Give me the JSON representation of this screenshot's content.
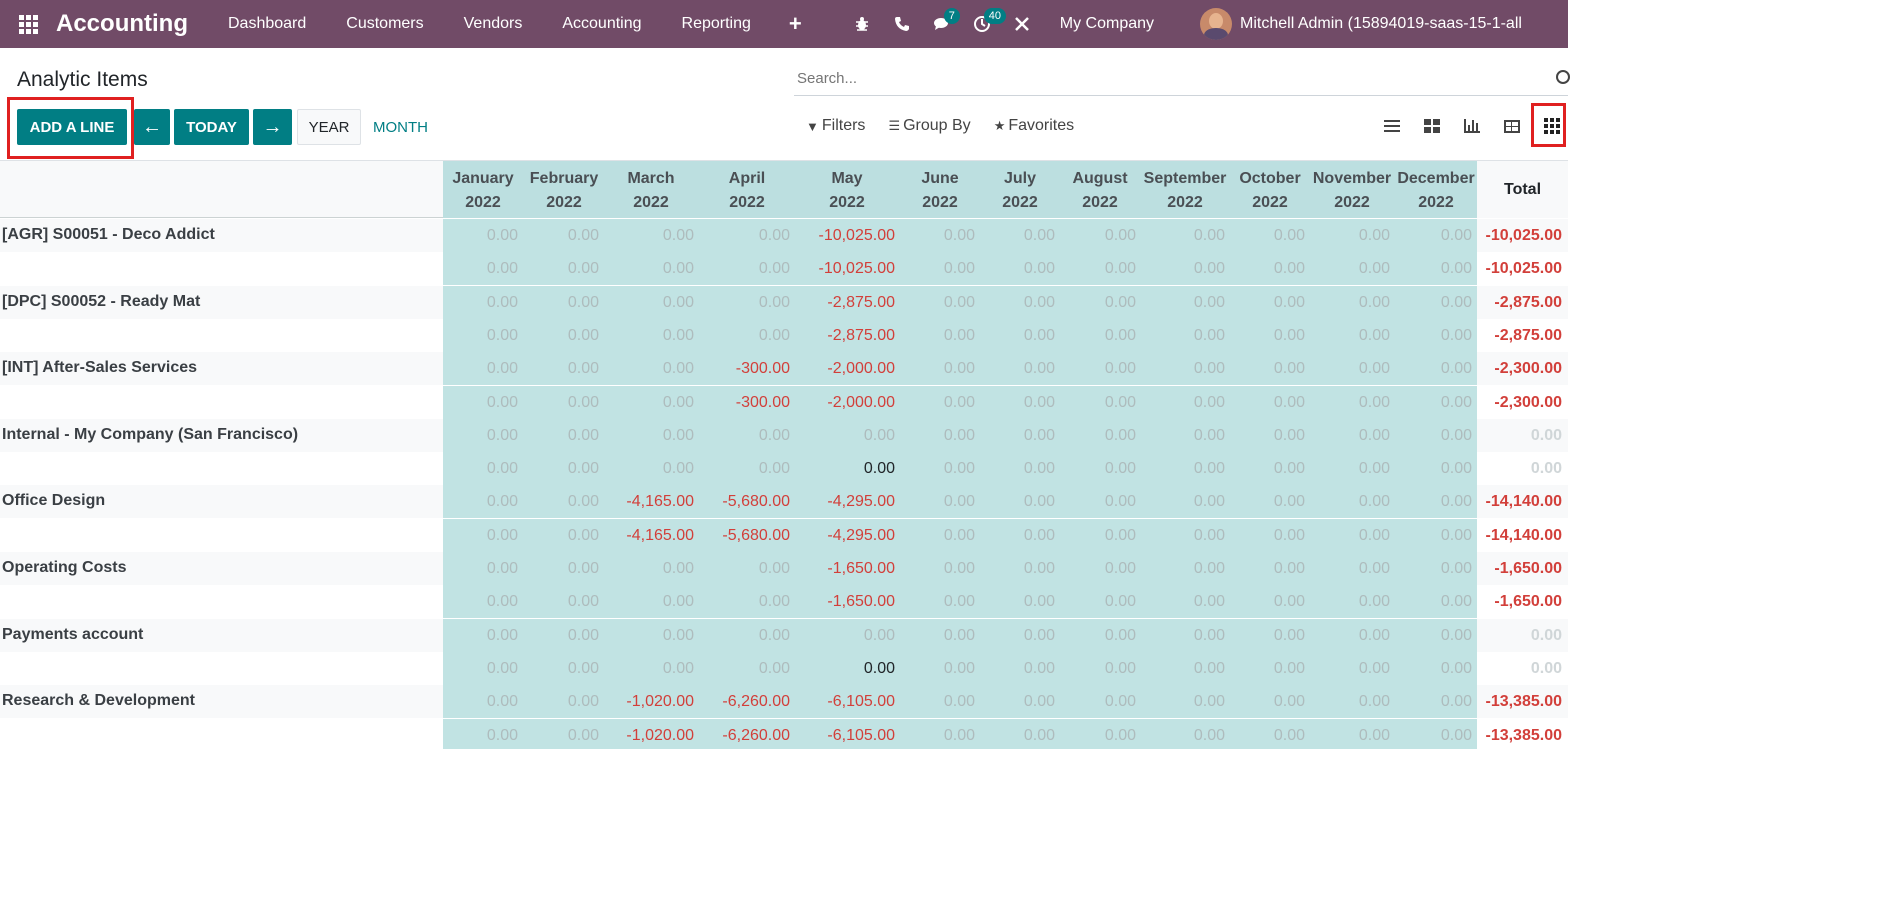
{
  "navbar": {
    "app_name": "Accounting",
    "menu": [
      "Dashboard",
      "Customers",
      "Vendors",
      "Accounting",
      "Reporting"
    ],
    "plus": "+",
    "messages_count": "7",
    "activities_count": "40",
    "company": "My Company",
    "user": "Mitchell Admin (15894019-saas-15-1-all"
  },
  "page": {
    "title": "Analytic Items",
    "search_placeholder": "Search..."
  },
  "toolbar": {
    "add_line": "ADD A LINE",
    "today": "TODAY",
    "year": "YEAR",
    "month": "MONTH",
    "filters": "Filters",
    "group_by": "Group By",
    "favorites": "Favorites"
  },
  "grid": {
    "months": [
      [
        "January",
        "2022"
      ],
      [
        "February",
        "2022"
      ],
      [
        "March",
        "2022"
      ],
      [
        "April",
        "2022"
      ],
      [
        "May",
        "2022"
      ],
      [
        "June",
        "2022"
      ],
      [
        "July",
        "2022"
      ],
      [
        "August",
        "2022"
      ],
      [
        "September",
        "2022"
      ],
      [
        "October",
        "2022"
      ],
      [
        "November",
        "2022"
      ],
      [
        "December",
        "2022"
      ]
    ],
    "total_label": "Total",
    "rows": [
      {
        "label": "[AGR] S00051 - Deco Addict",
        "values": [
          "0.00",
          "0.00",
          "0.00",
          "0.00",
          "-10,025.00",
          "0.00",
          "0.00",
          "0.00",
          "0.00",
          "0.00",
          "0.00",
          "0.00"
        ],
        "total": "-10,025.00"
      },
      {
        "label": "",
        "values": [
          "0.00",
          "0.00",
          "0.00",
          "0.00",
          "-10,025.00",
          "0.00",
          "0.00",
          "0.00",
          "0.00",
          "0.00",
          "0.00",
          "0.00"
        ],
        "total": "-10,025.00"
      },
      {
        "label": "[DPC] S00052 - Ready Mat",
        "values": [
          "0.00",
          "0.00",
          "0.00",
          "0.00",
          "-2,875.00",
          "0.00",
          "0.00",
          "0.00",
          "0.00",
          "0.00",
          "0.00",
          "0.00"
        ],
        "total": "-2,875.00"
      },
      {
        "label": "",
        "values": [
          "0.00",
          "0.00",
          "0.00",
          "0.00",
          "-2,875.00",
          "0.00",
          "0.00",
          "0.00",
          "0.00",
          "0.00",
          "0.00",
          "0.00"
        ],
        "total": "-2,875.00"
      },
      {
        "label": "[INT] After-Sales Services",
        "values": [
          "0.00",
          "0.00",
          "0.00",
          "-300.00",
          "-2,000.00",
          "0.00",
          "0.00",
          "0.00",
          "0.00",
          "0.00",
          "0.00",
          "0.00"
        ],
        "total": "-2,300.00"
      },
      {
        "label": "",
        "values": [
          "0.00",
          "0.00",
          "0.00",
          "-300.00",
          "-2,000.00",
          "0.00",
          "0.00",
          "0.00",
          "0.00",
          "0.00",
          "0.00",
          "0.00"
        ],
        "total": "-2,300.00"
      },
      {
        "label": "Internal - My Company (San Francisco)",
        "values": [
          "0.00",
          "0.00",
          "0.00",
          "0.00",
          "0.00",
          "0.00",
          "0.00",
          "0.00",
          "0.00",
          "0.00",
          "0.00",
          "0.00"
        ],
        "total": "0.00"
      },
      {
        "label": "",
        "values": [
          "0.00",
          "0.00",
          "0.00",
          "0.00",
          "0.00",
          "0.00",
          "0.00",
          "0.00",
          "0.00",
          "0.00",
          "0.00",
          "0.00"
        ],
        "total": "0.00",
        "strong_col": 4
      },
      {
        "label": "Office Design",
        "values": [
          "0.00",
          "0.00",
          "-4,165.00",
          "-5,680.00",
          "-4,295.00",
          "0.00",
          "0.00",
          "0.00",
          "0.00",
          "0.00",
          "0.00",
          "0.00"
        ],
        "total": "-14,140.00"
      },
      {
        "label": "",
        "values": [
          "0.00",
          "0.00",
          "-4,165.00",
          "-5,680.00",
          "-4,295.00",
          "0.00",
          "0.00",
          "0.00",
          "0.00",
          "0.00",
          "0.00",
          "0.00"
        ],
        "total": "-14,140.00"
      },
      {
        "label": "Operating Costs",
        "values": [
          "0.00",
          "0.00",
          "0.00",
          "0.00",
          "-1,650.00",
          "0.00",
          "0.00",
          "0.00",
          "0.00",
          "0.00",
          "0.00",
          "0.00"
        ],
        "total": "-1,650.00"
      },
      {
        "label": "",
        "values": [
          "0.00",
          "0.00",
          "0.00",
          "0.00",
          "-1,650.00",
          "0.00",
          "0.00",
          "0.00",
          "0.00",
          "0.00",
          "0.00",
          "0.00"
        ],
        "total": "-1,650.00"
      },
      {
        "label": "Payments account",
        "values": [
          "0.00",
          "0.00",
          "0.00",
          "0.00",
          "0.00",
          "0.00",
          "0.00",
          "0.00",
          "0.00",
          "0.00",
          "0.00",
          "0.00"
        ],
        "total": "0.00"
      },
      {
        "label": "",
        "values": [
          "0.00",
          "0.00",
          "0.00",
          "0.00",
          "0.00",
          "0.00",
          "0.00",
          "0.00",
          "0.00",
          "0.00",
          "0.00",
          "0.00"
        ],
        "total": "0.00",
        "strong_col": 4
      },
      {
        "label": "Research & Development",
        "values": [
          "0.00",
          "0.00",
          "-1,020.00",
          "-6,260.00",
          "-6,105.00",
          "0.00",
          "0.00",
          "0.00",
          "0.00",
          "0.00",
          "0.00",
          "0.00"
        ],
        "total": "-13,385.00"
      },
      {
        "label": "",
        "values": [
          "0.00",
          "0.00",
          "-1,020.00",
          "-6,260.00",
          "-6,105.00",
          "0.00",
          "0.00",
          "0.00",
          "0.00",
          "0.00",
          "0.00",
          "0.00"
        ],
        "total": "-13,385.00"
      }
    ]
  }
}
